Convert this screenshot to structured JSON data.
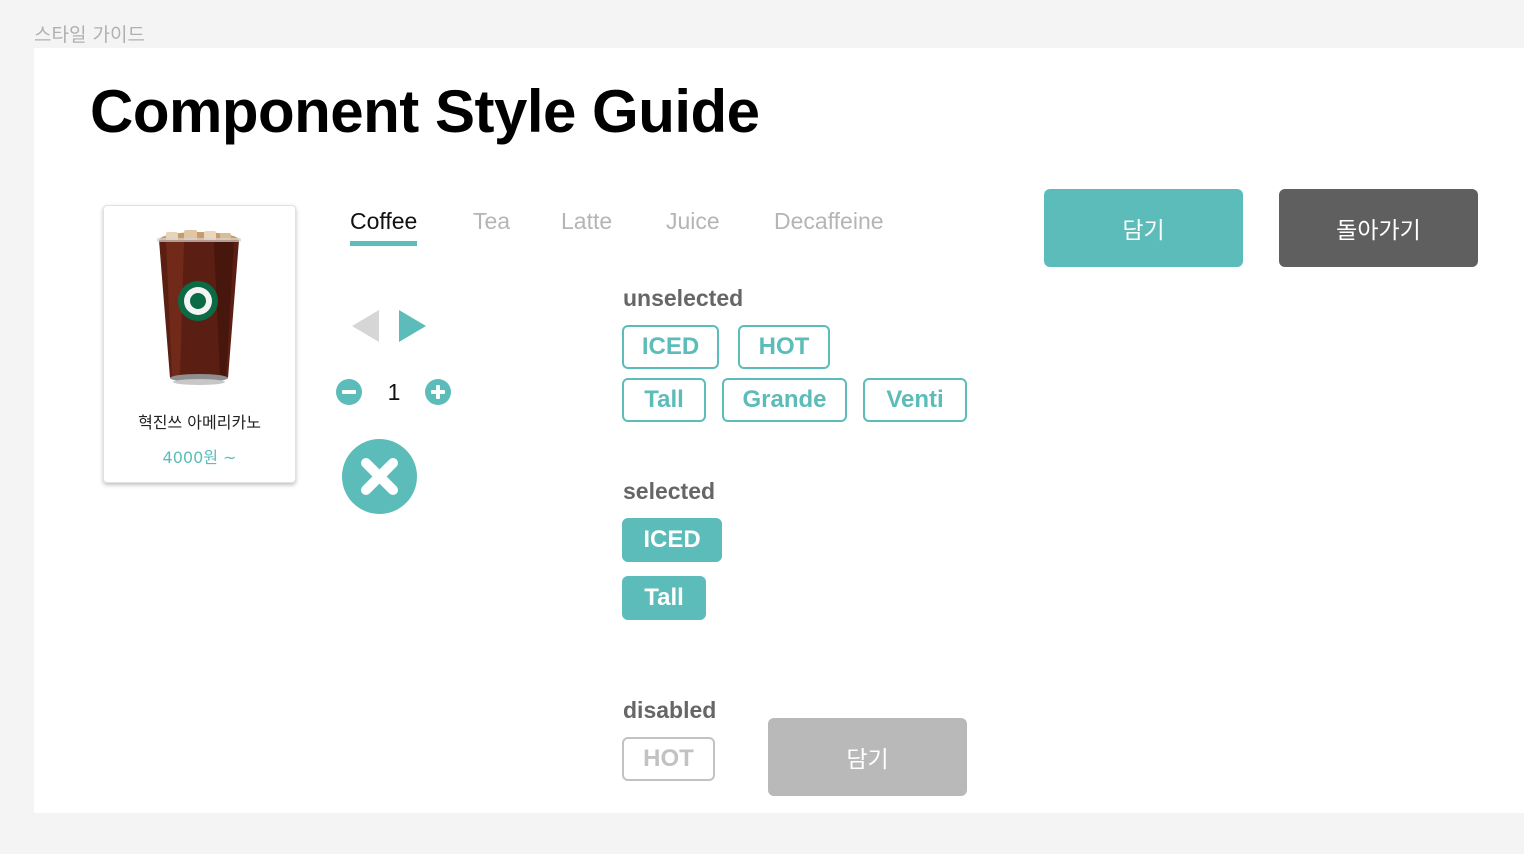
{
  "frame_label": "스타일 가이드",
  "title": "Component Style Guide",
  "product": {
    "name": "혁진쓰 아메리카노",
    "price": "4000원 ~",
    "image": "iced-americano-cup"
  },
  "tabs": [
    {
      "label": "Coffee",
      "active": true
    },
    {
      "label": "Tea",
      "active": false
    },
    {
      "label": "Latte",
      "active": false
    },
    {
      "label": "Juice",
      "active": false
    },
    {
      "label": "Decaffeine",
      "active": false
    }
  ],
  "stepper": {
    "value": "1"
  },
  "sections": {
    "unselected": "unselected",
    "selected": "selected",
    "disabled": "disabled"
  },
  "unselected_options": {
    "temperature": [
      "ICED",
      "HOT"
    ],
    "size": [
      "Tall",
      "Grande",
      "Venti"
    ]
  },
  "selected_options": {
    "temperature": "ICED",
    "size": "Tall"
  },
  "disabled_option": "HOT",
  "buttons": {
    "add": "담기",
    "back": "돌아가기",
    "add_disabled": "담기"
  },
  "colors": {
    "accent": "#5cbcb9",
    "dark_button": "#5f5f5f",
    "disabled": "#b9b9b9",
    "inactive_text": "#b5b5b5"
  }
}
